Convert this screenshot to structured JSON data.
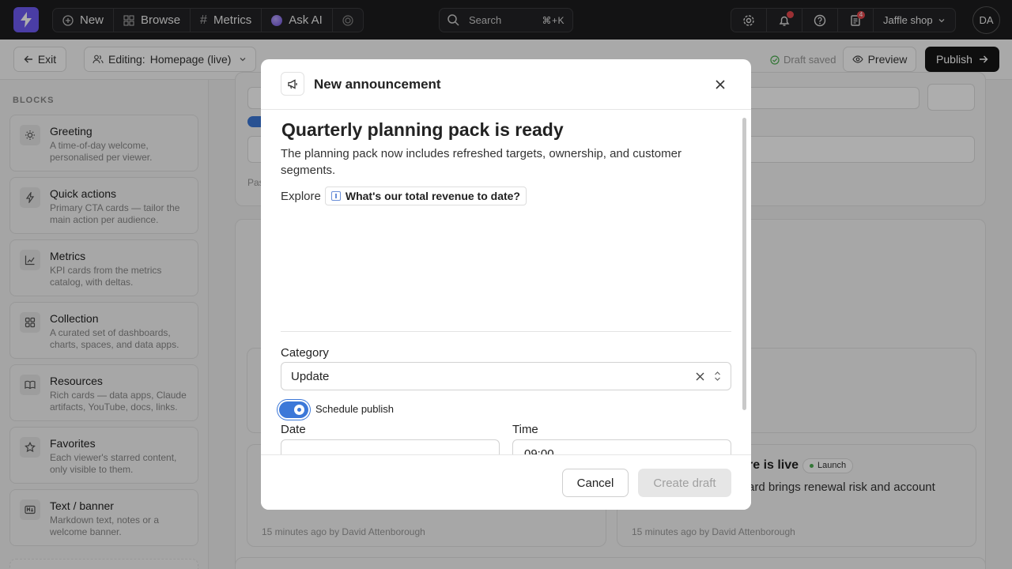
{
  "topbar": {
    "nav": [
      {
        "label": "New",
        "icon": "plus-circle-icon"
      },
      {
        "label": "Browse",
        "icon": "grid-icon"
      },
      {
        "label": "Metrics",
        "icon": "hash-icon"
      },
      {
        "label": "Ask AI",
        "icon": "ai-orb-icon"
      }
    ],
    "search_label": "Search",
    "search_shortcut": "⌘+K",
    "notifications_badge": "4",
    "workspace": "Jaffle shop",
    "avatar_initials": "DA"
  },
  "subbar": {
    "exit_label": "Exit",
    "editing_prefix": "Editing:",
    "editing_page": "Homepage (live)",
    "status": "Draft saved",
    "preview_label": "Preview",
    "publish_label": "Publish"
  },
  "sidebar": {
    "heading": "BLOCKS",
    "blocks": [
      {
        "title": "Greeting",
        "desc": "A time-of-day welcome, personalised per viewer.",
        "icon": "sun-icon"
      },
      {
        "title": "Quick actions",
        "desc": "Primary CTA cards — tailor the main action per audience.",
        "icon": "bolt-icon"
      },
      {
        "title": "Metrics",
        "desc": "KPI cards from the metrics catalog, with deltas.",
        "icon": "chart-icon"
      },
      {
        "title": "Collection",
        "desc": "A curated set of dashboards, charts, spaces, and data apps.",
        "icon": "grid-icon"
      },
      {
        "title": "Resources",
        "desc": "Rich cards — data apps, Claude artifacts, YouTube, docs, links.",
        "icon": "book-icon"
      },
      {
        "title": "Favorites",
        "desc": "Each viewer's starred content, only visible to them.",
        "icon": "star-icon"
      },
      {
        "title": "Text / banner",
        "desc": "Markdown text, notes or a welcome banner.",
        "icon": "markdown-icon"
      }
    ]
  },
  "background": {
    "card_meta_left": "15 minutes ago by David Attenborough",
    "card_meta_right": "15 minutes ago by David Attenborough",
    "card_title_right": "re is live",
    "card_tag": "Launch",
    "card_text_right": "ard brings renewal risk and account",
    "partial_text": "Pas"
  },
  "modal": {
    "title": "New announcement",
    "headline": "Quarterly planning pack is ready",
    "body": "The planning pack now includes refreshed targets, ownership, and customer segments.",
    "explore_label": "Explore",
    "explore_chip": "What's our total revenue to date?",
    "category_label": "Category",
    "category_value": "Update",
    "schedule_label": "Schedule publish",
    "schedule_on": true,
    "date_label": "Date",
    "time_label": "Time",
    "time_value": "09:00",
    "cancel_label": "Cancel",
    "create_label": "Create draft"
  }
}
